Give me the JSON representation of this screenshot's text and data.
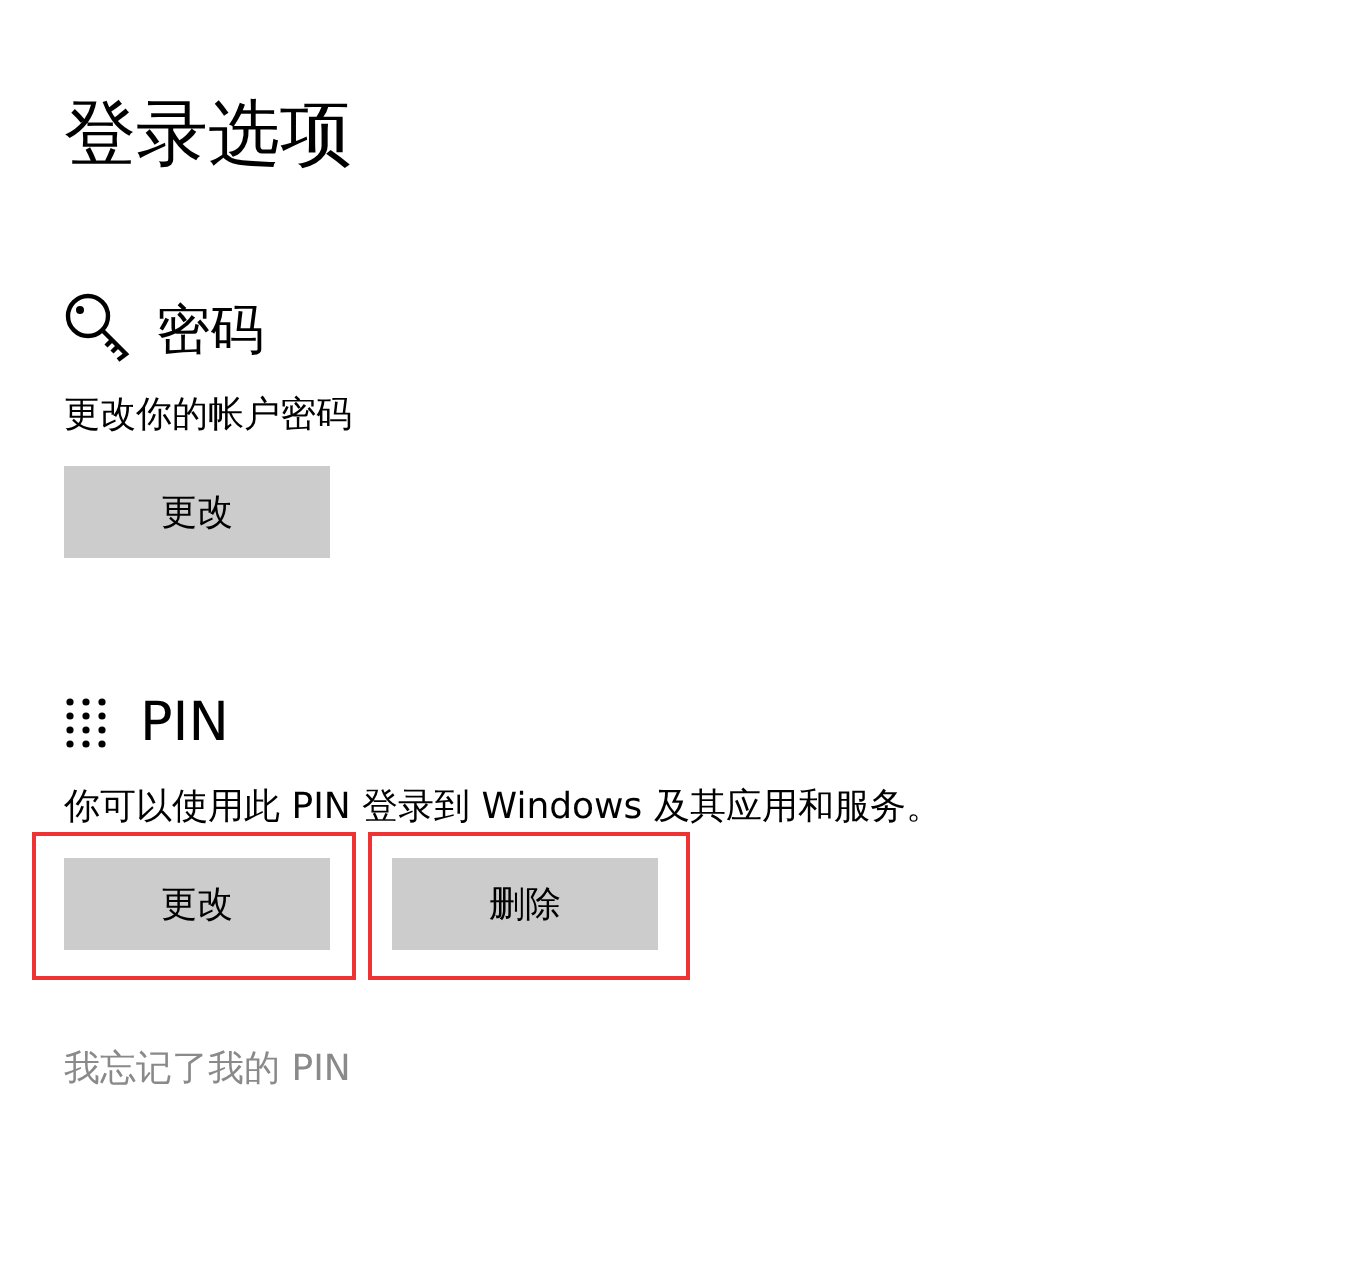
{
  "page_title": "登录选项",
  "sections": [
    {
      "kind": "password",
      "heading": "密码",
      "description": "更改你的帐户密码",
      "buttons": [
        {
          "label": "更改",
          "highlighted": false
        }
      ]
    },
    {
      "kind": "pin",
      "heading": "PIN",
      "description": "你可以使用此 PIN 登录到 Windows 及其应用和服务。",
      "buttons": [
        {
          "label": "更改",
          "highlighted": true
        },
        {
          "label": "删除",
          "highlighted": true
        }
      ],
      "link": "我忘记了我的 PIN"
    }
  ]
}
